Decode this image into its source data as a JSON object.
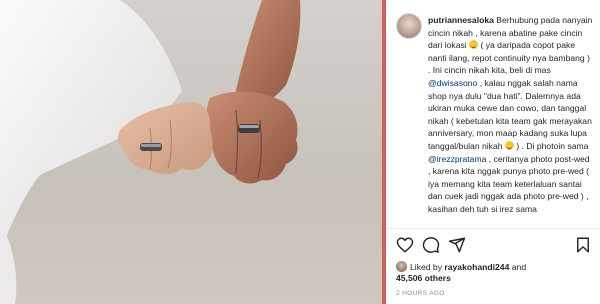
{
  "post": {
    "username": "putriannesaloka",
    "caption_parts": [
      {
        "t": "text",
        "v": " Berhubung pada nanyain cincin nikah , karena abatine pake cincin dari lokasi "
      },
      {
        "t": "emoji",
        "v": "grinning-face"
      },
      {
        "t": "text",
        "v": " ( ya daripada copot pake nanti ilang, repot continuity nya bambang ) . Ini cincin nikah kita, beli di mas "
      },
      {
        "t": "mention",
        "v": "@dwisasono"
      },
      {
        "t": "text",
        "v": " , kalau nggak salah nama shop nya dulu \"dua hati\". Dalemnya ada ukiran muka cewe dan cowo, dan tanggal nikah ( kebetulan kita team gak merayakan anniversary, mon maap kadang suka lupa tanggal/bulan nikah "
      },
      {
        "t": "emoji",
        "v": "grinning-face"
      },
      {
        "t": "text",
        "v": " ) . Di photoin sama "
      },
      {
        "t": "mention",
        "v": "@irezzpratama"
      },
      {
        "t": "text",
        "v": " , ceritanya photo post-wed , karena kita nggak punya photo pre-wed ( iya memang kita team keterlaluan santai dan cuek jadi nggak ada photo pre-wed ) , kasihan deh tuh si irez sama "
      }
    ]
  },
  "actions": {
    "like": "heart-icon",
    "comment": "comment-icon",
    "share": "share-icon",
    "save": "bookmark-icon"
  },
  "likes": {
    "prefix": "Liked by",
    "user": "rayakohandi244",
    "connector": "and",
    "others": "45,506 others"
  },
  "timestamp": "2 HOURS AGO",
  "colors": {
    "accent_divider": "#c9645d",
    "mention": "#00376b",
    "text": "#262626",
    "muted": "#8e8e8e"
  }
}
